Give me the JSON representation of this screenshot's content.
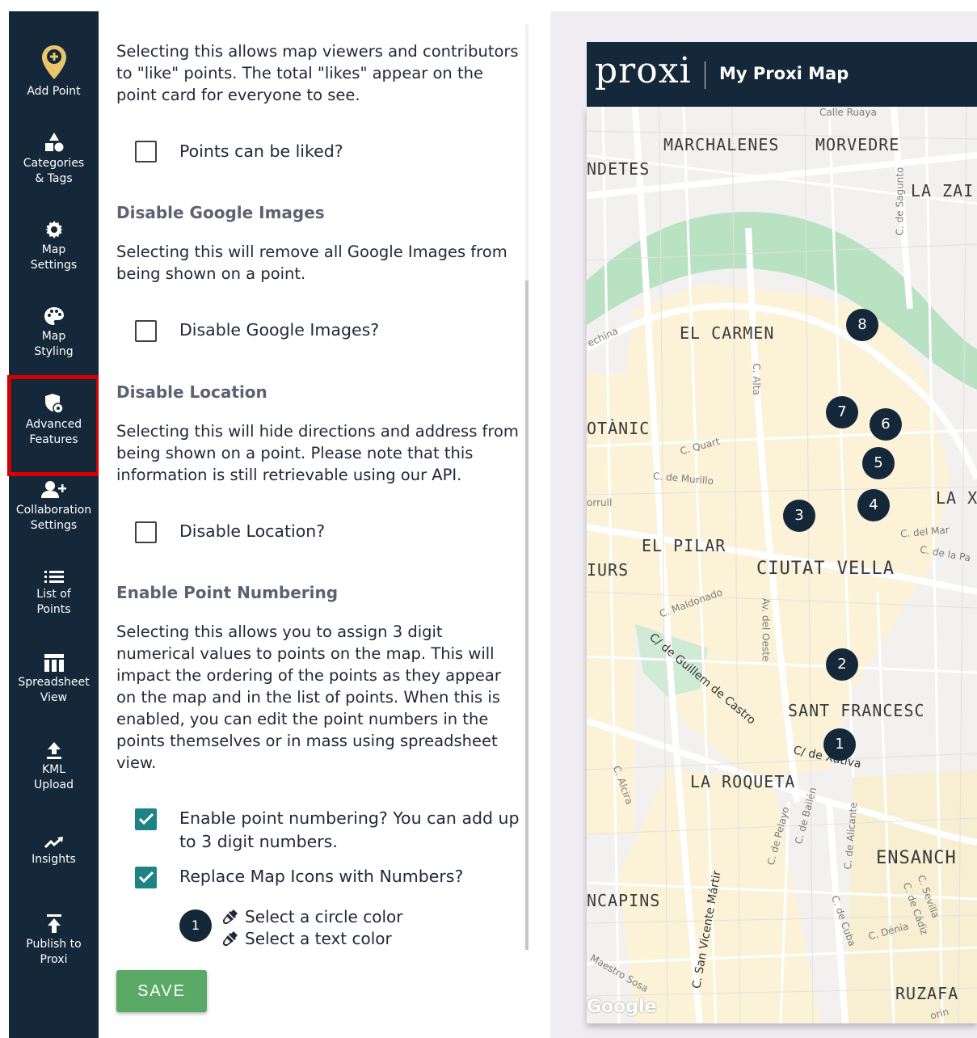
{
  "sidebar": {
    "items": [
      {
        "label": "Add Point",
        "icon": "map-pin-plus-icon"
      },
      {
        "label": "Categories\n& Tags",
        "icon": "shapes-icon"
      },
      {
        "label": "Map\nSettings",
        "icon": "gear-icon"
      },
      {
        "label": "Map\nStyling",
        "icon": "palette-icon"
      },
      {
        "label": "Advanced\nFeatures",
        "icon": "shield-icon",
        "active": true
      },
      {
        "label": "Collaboration\nSettings",
        "icon": "add-user-icon"
      },
      {
        "label": "List of\nPoints",
        "icon": "list-icon"
      },
      {
        "label": "Spreadsheet\nView",
        "icon": "table-icon"
      },
      {
        "label": "KML\nUpload",
        "icon": "upload-icon"
      },
      {
        "label": "Insights",
        "icon": "trending-icon"
      },
      {
        "label": "Publish to\nProxi",
        "icon": "publish-icon"
      }
    ],
    "active_outline_color": "#d40000"
  },
  "panel": {
    "likes_desc": "Selecting this allows map viewers and contributors to \"like\" points. The total \"likes\" appear on the point card for everyone to see.",
    "likes_checkbox": {
      "label": "Points can be liked?",
      "checked": false
    },
    "google_heading": "Disable Google Images",
    "google_desc": "Selecting this will remove all Google Images from being shown on a point.",
    "google_checkbox": {
      "label": "Disable Google Images?",
      "checked": false
    },
    "location_heading": "Disable Location",
    "location_desc": "Selecting this will hide directions and address from being shown on a point. Please note that this information is still retrievable using our API.",
    "location_checkbox": {
      "label": "Disable Location?",
      "checked": false
    },
    "numbering_heading": "Enable Point Numbering",
    "numbering_desc": "Selecting this allows you to assign 3 digit numerical values to points on the map. This will impact the ordering of the points as they appear on the map and in the list of points. When this is enabled, you can edit the point numbers in the points themselves or in mass using spreadsheet view.",
    "numbering_checkbox": {
      "label": "Enable point numbering? You can add up to 3 digit numbers.",
      "checked": true
    },
    "replace_checkbox": {
      "label": "Replace Map Icons with Numbers?",
      "checked": true
    },
    "preview_number": "1",
    "circle_color_label": "Select a circle color",
    "text_color_label": "Select a text color",
    "save_label": "SAVE",
    "checkbox_color": "#1e8386",
    "save_color": "#5aa966"
  },
  "map_preview": {
    "logo": "proxi",
    "title": "My Proxi Map",
    "header_color": "#14283a",
    "area_labels": [
      "MARCHALENES",
      "MORVEDRE",
      "NDETES",
      "LA ZAI",
      "EL CARMEN",
      "OTÀNIC",
      "LA X",
      "EL PILAR",
      "IURS",
      "CIUTAT VELLA",
      "SANT FRANCESC",
      "LA ROQUETA",
      "ENSANCH",
      "NCAPINS",
      "RUZAFA"
    ],
    "street_labels": [
      "Calle Ruaya",
      "C. de Sagunto",
      "echina",
      "C. Alta",
      "C. Quart",
      "C. de Murillo",
      "orrull",
      "C. del Mar",
      "C. de la Pa",
      "C. Maldonado",
      "Av. del Oeste",
      "C/ de Guillem de Castro",
      "C/ de Xàtiva",
      "C. Alcira",
      "C. de Bailén",
      "C. de Pelayo",
      "C. de Alicante",
      "C. de Cuba",
      "C. Dénia",
      "C. Sevilla",
      "C. de Cádiz",
      "C. San Vicente Mártir",
      "Maestro Sosa",
      "orin"
    ],
    "markers": [
      "1",
      "2",
      "3",
      "4",
      "5",
      "6",
      "7",
      "8"
    ],
    "attribution": "Google"
  }
}
